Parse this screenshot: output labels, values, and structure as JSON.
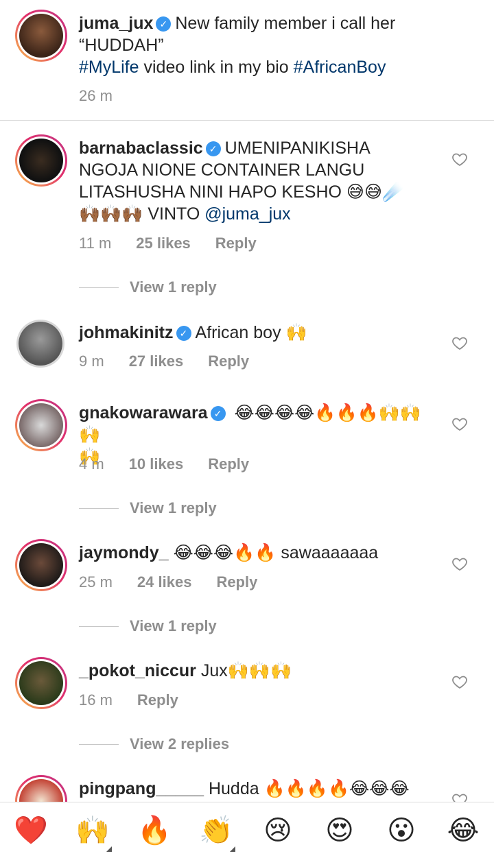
{
  "caption": {
    "username": "juma_jux",
    "text_line1": "New family member i call her",
    "text_line2": "“HUDDAH”",
    "hashtag1": "#MyLife",
    "text_mid": " video link in my bio ",
    "hashtag2": "#AfricanBoy",
    "time": "26 m"
  },
  "comments": [
    {
      "username": "barnabaclassic",
      "text_line1": "UMENIPANIKISHA",
      "text_line2": "NGOJA NIONE CONTAINER LANGU",
      "text_line3": "LITASHUSHA NINI HAPO KESHO 😅😅☄️",
      "text_line4a": "🙌🏾🙌🏾🙌🏾 VINTO ",
      "mention": "@juma_jux",
      "time": "11 m",
      "likes": "25 likes",
      "reply": "Reply",
      "view_replies": "View 1 reply"
    },
    {
      "username": "johmakinitz",
      "text": "African boy 🙌",
      "time": "9 m",
      "likes": "27 likes",
      "reply": "Reply"
    },
    {
      "username": "gnakowarawara",
      "text_line1": "😂😂😂😂🔥🔥🔥🙌🙌🙌",
      "text_line2": "🙌",
      "time": "4 m",
      "likes": "10 likes",
      "reply": "Reply",
      "view_replies": "View 1 reply"
    },
    {
      "username": "jaymondy_",
      "text": "😂😂😂🔥🔥  sawaaaaaaa",
      "time": "25 m",
      "likes": "24 likes",
      "reply": "Reply",
      "view_replies": "View 1 reply"
    },
    {
      "username": "_pokot_niccur",
      "text": "Jux🙌🙌🙌",
      "time": "16 m",
      "reply": "Reply",
      "view_replies": "View 2 replies"
    },
    {
      "username": "pingpang_____",
      "text": "Hudda 🔥🔥🔥🔥😂😂😂"
    }
  ],
  "reactions": [
    "❤️",
    "🙌",
    "🔥",
    "👏",
    "😢",
    "😍",
    "😮",
    "😂"
  ],
  "colors": {
    "verified": "#3897f0",
    "link": "#00376b",
    "muted": "#8e8e8e"
  },
  "icons": {
    "verified": "verified-badge-icon",
    "like": "heart-outline-icon"
  }
}
